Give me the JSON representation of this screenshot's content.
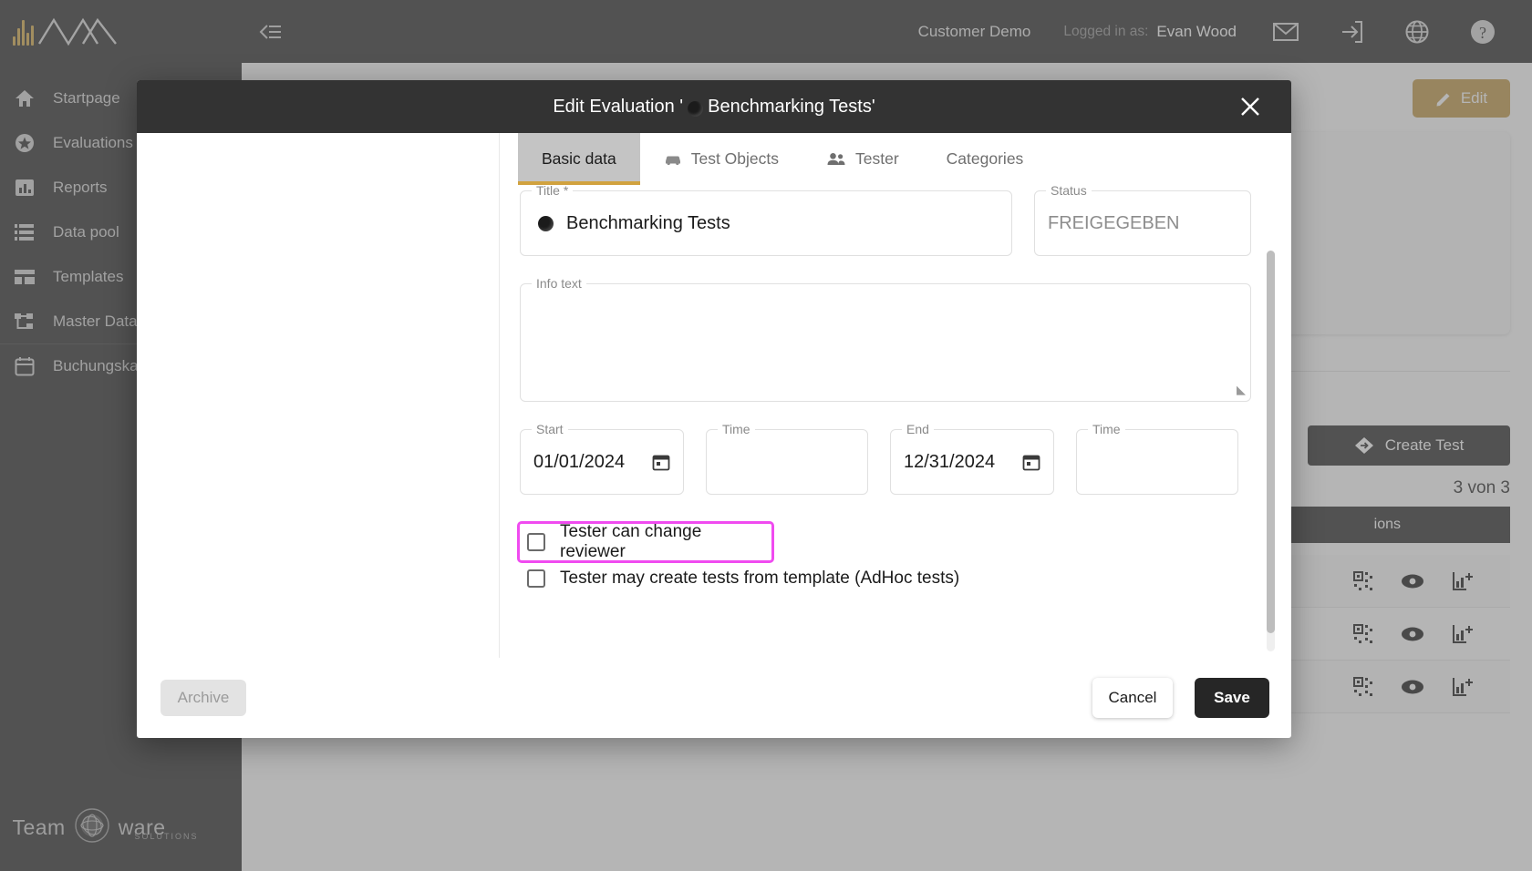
{
  "topbar": {
    "tenant": "Customer Demo",
    "logged_in_label": "Logged in as:",
    "username": "Evan Wood",
    "icons": [
      "mail-icon",
      "logout-icon",
      "globe-icon",
      "help-icon"
    ],
    "collapse_icon": "collapse-sidebar-icon"
  },
  "sidebar": {
    "items": [
      {
        "label": "Startpage",
        "icon": "home-icon"
      },
      {
        "label": "Evaluations",
        "icon": "star-badge-icon"
      },
      {
        "label": "Reports",
        "icon": "bar-chart-icon"
      },
      {
        "label": "Data pool",
        "icon": "database-list-icon"
      },
      {
        "label": "Templates",
        "icon": "layout-template-icon"
      },
      {
        "label": "Master Data",
        "icon": "hierarchy-icon"
      },
      {
        "label": "Buchungskale",
        "icon": "calendar-icon"
      }
    ],
    "brand": {
      "team": "Team",
      "ware": "ware",
      "solutions": "SOLUTIONS"
    }
  },
  "page": {
    "edit_button": "Edit",
    "create_test_button": "Create Test",
    "count_label": "3 von 3",
    "table_header_partial": "ions",
    "row_icons": [
      "qr-code-icon",
      "eye-icon",
      "add-chart-icon"
    ]
  },
  "modal": {
    "title_prefix": "Edit Evaluation '",
    "title_name": "Benchmarking Tests",
    "title_suffix": "'",
    "close_icon": "close-icon",
    "tabs": [
      {
        "label": "Basic data",
        "icon": null,
        "active": true
      },
      {
        "label": "Test Objects",
        "icon": "car-icon",
        "active": false
      },
      {
        "label": "Tester",
        "icon": "people-icon",
        "active": false
      },
      {
        "label": "Categories",
        "icon": null,
        "active": false
      }
    ],
    "fields": {
      "title": {
        "label": "Title *",
        "value": "Benchmarking Tests",
        "has_dot": true
      },
      "status": {
        "label": "Status",
        "value": "FREIGEGEBEN"
      },
      "info_text": {
        "label": "Info text",
        "value": "",
        "placeholder": ""
      },
      "start": {
        "label": "Start",
        "value": "01/01/2024",
        "icon": "calendar-icon"
      },
      "start_time": {
        "label": "Time",
        "value": ""
      },
      "end": {
        "label": "End",
        "value": "12/31/2024",
        "icon": "calendar-icon"
      },
      "end_time": {
        "label": "Time",
        "value": ""
      }
    },
    "checkboxes": [
      {
        "label": "Tester can change reviewer",
        "checked": false,
        "focused": true
      },
      {
        "label": "Tester may create tests from template (AdHoc tests)",
        "checked": false,
        "focused": false
      }
    ],
    "footer": {
      "archive": "Archive",
      "cancel": "Cancel",
      "save": "Save"
    }
  },
  "colors": {
    "accent_gold": "#bf9540",
    "tab_underline": "#d1a23f",
    "focus_magenta": "#f04bf0",
    "dark": "#242424",
    "modal_header": "#333333"
  }
}
